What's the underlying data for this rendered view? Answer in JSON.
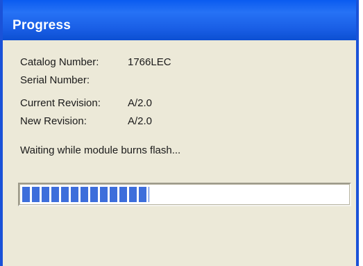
{
  "window": {
    "title": "Progress"
  },
  "fields": {
    "catalog_number_label": "Catalog Number:",
    "catalog_number_value": "1766LEC",
    "serial_number_label": "Serial Number:",
    "serial_number_value": "",
    "current_revision_label": "Current Revision:",
    "current_revision_value": "A/2.0",
    "new_revision_label": "New Revision:",
    "new_revision_value": "A/2.0"
  },
  "status": {
    "text": "Waiting while module burns flash..."
  },
  "progress": {
    "fraction": 0.39,
    "fill_color": "#3d6edb"
  },
  "colors": {
    "titlebar": "#1a5fe6",
    "dialog_background": "#ece9d8"
  }
}
